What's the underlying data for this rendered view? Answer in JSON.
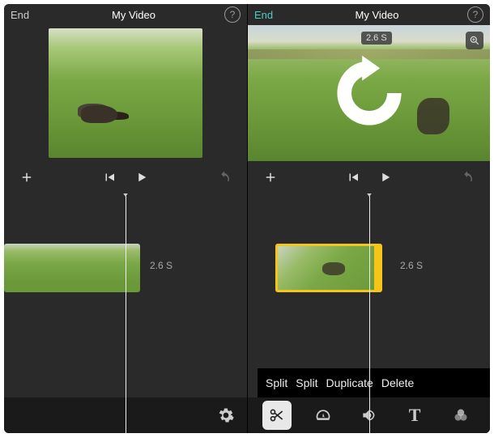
{
  "left": {
    "header": {
      "end_label": "End",
      "title": "My Video"
    },
    "preview": {},
    "controls": {
      "add": "+",
      "prev": "prev",
      "play": "play",
      "undo": "undo"
    },
    "timeline": {
      "clip_duration": "2.6 S"
    },
    "bottom": {
      "settings": "gear"
    }
  },
  "right": {
    "header": {
      "end_label": "End",
      "title": "My Video"
    },
    "preview": {
      "duration_badge": "2.6 S",
      "zoom": "zoom-in",
      "rotate_overlay": true
    },
    "controls": {
      "add": "+",
      "prev": "prev",
      "play": "play",
      "undo": "undo"
    },
    "timeline": {
      "clip_duration": "2.6 S"
    },
    "actions": {
      "split1": "Split",
      "split2": "Split",
      "duplicate": "Duplicate",
      "delete": "Delete"
    },
    "bottom": {
      "cut": "scissors",
      "speed": "speedometer",
      "audio": "volume",
      "text_label": "T",
      "filters": "color-filter"
    }
  }
}
